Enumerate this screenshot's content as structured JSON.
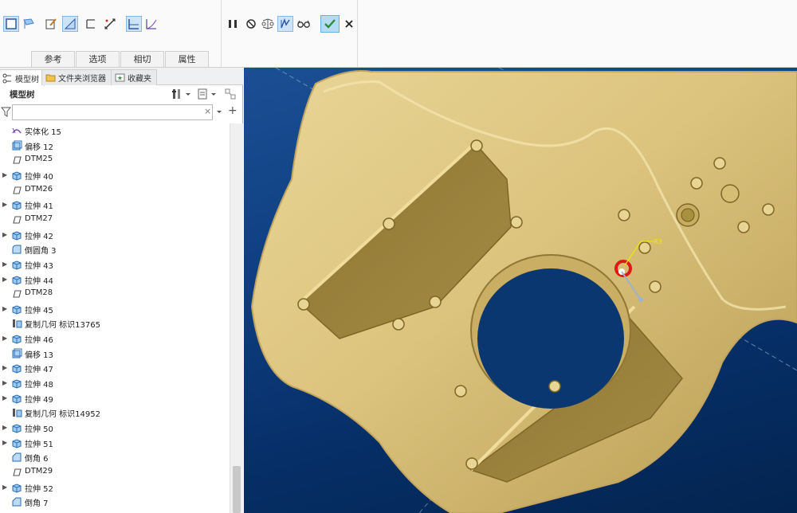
{
  "ribbon": {
    "tabs": [
      "参考",
      "选项",
      "相切",
      "属性"
    ]
  },
  "panel": {
    "tabs": [
      "模型树",
      "文件夹浏览器",
      "收藏夹"
    ],
    "tree_title": "模型树",
    "filter_placeholder": "",
    "clear_glyph": "×",
    "add_glyph": "+"
  },
  "tree": {
    "items": [
      {
        "label": "实体化 15",
        "icon": "solidify-icon",
        "expandable": false
      },
      {
        "label": "偏移 12",
        "icon": "offset-icon",
        "expandable": false
      },
      {
        "label": "DTM25",
        "icon": "datum-plane-icon",
        "expandable": false
      },
      {
        "label": "拉伸 40",
        "icon": "extrude-icon",
        "expandable": true
      },
      {
        "label": "DTM26",
        "icon": "datum-plane-icon",
        "expandable": false
      },
      {
        "label": "拉伸 41",
        "icon": "extrude-icon",
        "expandable": true
      },
      {
        "label": "DTM27",
        "icon": "datum-plane-icon",
        "expandable": false
      },
      {
        "label": "拉伸 42",
        "icon": "extrude-icon",
        "expandable": true
      },
      {
        "label": "倒圆角 3",
        "icon": "round-icon",
        "expandable": false
      },
      {
        "label": "拉伸 43",
        "icon": "extrude-icon",
        "expandable": true
      },
      {
        "label": "拉伸 44",
        "icon": "extrude-icon",
        "expandable": true
      },
      {
        "label": "DTM28",
        "icon": "datum-plane-icon",
        "expandable": false
      },
      {
        "label": "拉伸 45",
        "icon": "extrude-icon",
        "expandable": true
      },
      {
        "label": "复制几何 标识13765",
        "icon": "copy-geometry-icon",
        "expandable": false
      },
      {
        "label": "拉伸 46",
        "icon": "extrude-icon",
        "expandable": true
      },
      {
        "label": "偏移 13",
        "icon": "offset-icon",
        "expandable": false
      },
      {
        "label": "拉伸 47",
        "icon": "extrude-icon",
        "expandable": true
      },
      {
        "label": "拉伸 48",
        "icon": "extrude-icon",
        "expandable": true
      },
      {
        "label": "拉伸 49",
        "icon": "extrude-icon",
        "expandable": true
      },
      {
        "label": "复制几何 标识14952",
        "icon": "copy-geometry-icon",
        "expandable": false
      },
      {
        "label": "拉伸 50",
        "icon": "extrude-icon",
        "expandable": true
      },
      {
        "label": "拉伸 51",
        "icon": "extrude-icon",
        "expandable": true
      },
      {
        "label": "倒角 6",
        "icon": "chamfer-icon",
        "expandable": false
      },
      {
        "label": "DTM29",
        "icon": "datum-plane-icon",
        "expandable": false
      },
      {
        "label": "拉伸 52",
        "icon": "extrude-icon",
        "expandable": true
      },
      {
        "label": "倒角 7",
        "icon": "chamfer-icon",
        "expandable": false
      }
    ]
  },
  "viewport": {
    "dimension_label": "R3"
  },
  "colors": {
    "accent": "#2a7ad4",
    "part": "#d9c27a",
    "confirm": "#2e8b3a",
    "background": "#0e3f82"
  }
}
